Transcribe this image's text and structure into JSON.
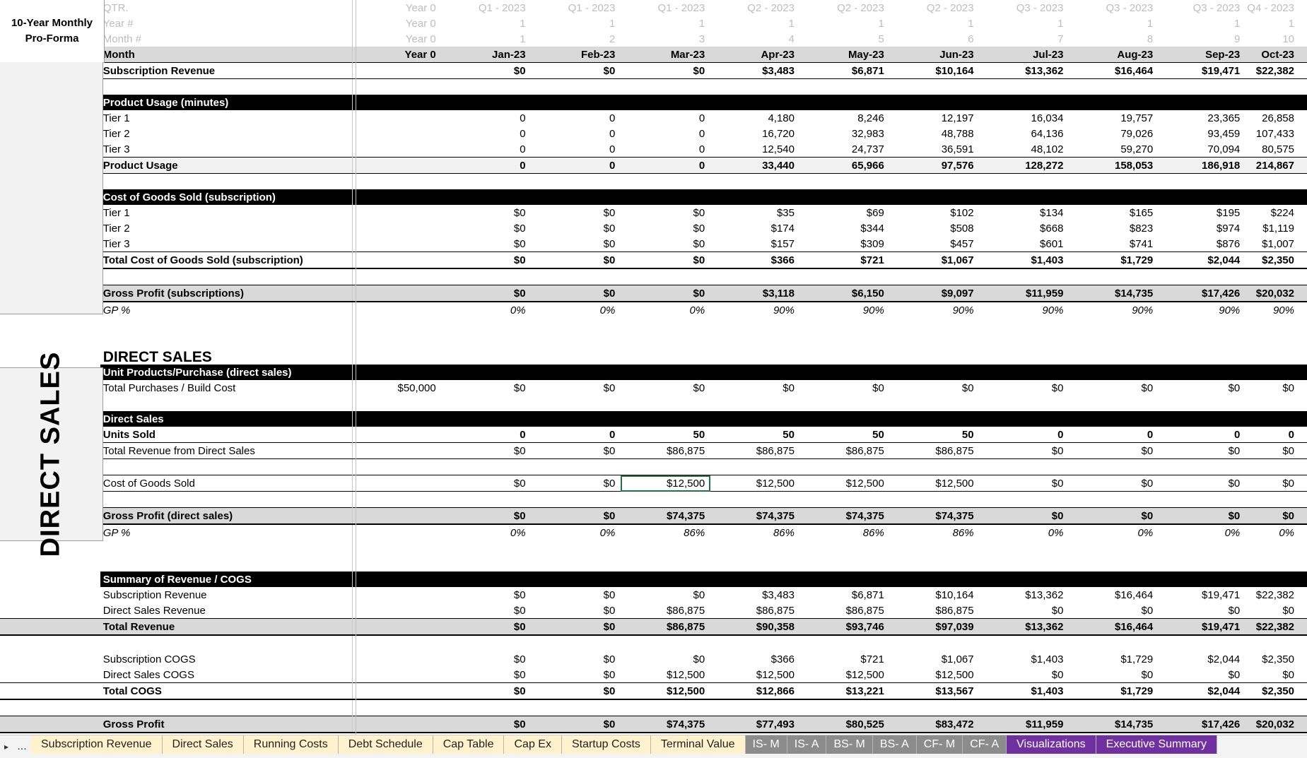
{
  "title_line1": "10-Year Monthly",
  "title_line2": "Pro-Forma",
  "side_label_direct": "DIRECT SALES",
  "header_rows": {
    "qtr_label": "QTR.",
    "year_label": "Year #",
    "month_num_label": "Month #",
    "year0": "Year 0",
    "qtr": [
      "Q1 - 2023",
      "Q1 - 2023",
      "Q1 - 2023",
      "Q2 - 2023",
      "Q2 - 2023",
      "Q2 - 2023",
      "Q3 - 2023",
      "Q3 - 2023",
      "Q3 - 2023",
      "Q4 - 2023"
    ],
    "year": [
      "1",
      "1",
      "1",
      "1",
      "1",
      "1",
      "1",
      "1",
      "1",
      "1"
    ],
    "month_num": [
      "1",
      "2",
      "3",
      "4",
      "5",
      "6",
      "7",
      "8",
      "9",
      "10"
    ]
  },
  "month_row": {
    "label": "Month",
    "year0": "Year 0",
    "months": [
      "Jan-23",
      "Feb-23",
      "Mar-23",
      "Apr-23",
      "May-23",
      "Jun-23",
      "Jul-23",
      "Aug-23",
      "Sep-23",
      "Oct-23"
    ]
  },
  "subscription_revenue": {
    "label": "Subscription Revenue",
    "values": [
      "$0",
      "$0",
      "$0",
      "$3,483",
      "$6,871",
      "$10,164",
      "$13,362",
      "$16,464",
      "$19,471",
      "$22,382"
    ]
  },
  "product_usage": {
    "header": "Product Usage (minutes)",
    "rows": [
      {
        "label": "Tier 1",
        "values": [
          "0",
          "0",
          "0",
          "4,180",
          "8,246",
          "12,197",
          "16,034",
          "19,757",
          "23,365",
          "26,858"
        ]
      },
      {
        "label": "Tier 2",
        "values": [
          "0",
          "0",
          "0",
          "16,720",
          "32,983",
          "48,788",
          "64,136",
          "79,026",
          "93,459",
          "107,433"
        ]
      },
      {
        "label": "Tier 3",
        "values": [
          "0",
          "0",
          "0",
          "12,540",
          "24,737",
          "36,591",
          "48,102",
          "59,270",
          "70,094",
          "80,575"
        ]
      }
    ],
    "total": {
      "label": "Product Usage",
      "values": [
        "0",
        "0",
        "0",
        "33,440",
        "65,966",
        "97,576",
        "128,272",
        "158,053",
        "186,918",
        "214,867"
      ]
    }
  },
  "cogs_sub": {
    "header": "Cost of Goods Sold (subscription)",
    "rows": [
      {
        "label": "Tier 1",
        "values": [
          "$0",
          "$0",
          "$0",
          "$35",
          "$69",
          "$102",
          "$134",
          "$165",
          "$195",
          "$224"
        ]
      },
      {
        "label": "Tier 2",
        "values": [
          "$0",
          "$0",
          "$0",
          "$174",
          "$344",
          "$508",
          "$668",
          "$823",
          "$974",
          "$1,119"
        ]
      },
      {
        "label": "Tier 3",
        "values": [
          "$0",
          "$0",
          "$0",
          "$157",
          "$309",
          "$457",
          "$601",
          "$741",
          "$876",
          "$1,007"
        ]
      }
    ],
    "total": {
      "label": "Total Cost of Goods Sold (subscription)",
      "values": [
        "$0",
        "$0",
        "$0",
        "$366",
        "$721",
        "$1,067",
        "$1,403",
        "$1,729",
        "$2,044",
        "$2,350"
      ]
    }
  },
  "gp_sub": {
    "label": "Gross Profit (subscriptions)",
    "values": [
      "$0",
      "$0",
      "$0",
      "$3,118",
      "$6,150",
      "$9,097",
      "$11,959",
      "$14,735",
      "$17,426",
      "$20,032"
    ]
  },
  "gp_sub_pct": {
    "label": "GP %",
    "values": [
      "0%",
      "0%",
      "0%",
      "90%",
      "90%",
      "90%",
      "90%",
      "90%",
      "90%",
      "90%"
    ]
  },
  "direct_sales_heading": "DIRECT SALES",
  "unit_products": {
    "header": "Unit Products/Purchase (direct sales)",
    "row": {
      "label": "Total Purchases / Build Cost",
      "year0": "$50,000",
      "values": [
        "$0",
        "$0",
        "$0",
        "$0",
        "$0",
        "$0",
        "$0",
        "$0",
        "$0",
        "$0"
      ]
    }
  },
  "direct_sales": {
    "header": "Direct Sales",
    "units": {
      "label": "Units Sold",
      "values": [
        "0",
        "0",
        "50",
        "50",
        "50",
        "50",
        "0",
        "0",
        "0",
        "0"
      ]
    },
    "revenue": {
      "label": "Total Revenue from Direct Sales",
      "values": [
        "$0",
        "$0",
        "$86,875",
        "$86,875",
        "$86,875",
        "$86,875",
        "$0",
        "$0",
        "$0",
        "$0"
      ]
    }
  },
  "direct_cogs": {
    "label": "Cost of Goods Sold",
    "values": [
      "$0",
      "$0",
      "$12,500",
      "$12,500",
      "$12,500",
      "$12,500",
      "$0",
      "$0",
      "$0",
      "$0"
    ]
  },
  "gp_direct": {
    "label": "Gross Profit (direct sales)",
    "values": [
      "$0",
      "$0",
      "$74,375",
      "$74,375",
      "$74,375",
      "$74,375",
      "$0",
      "$0",
      "$0",
      "$0"
    ]
  },
  "gp_direct_pct": {
    "label": "GP %",
    "values": [
      "0%",
      "0%",
      "86%",
      "86%",
      "86%",
      "86%",
      "0%",
      "0%",
      "0%",
      "0%"
    ]
  },
  "summary": {
    "header": "Summary of Revenue / COGS",
    "sub_rev": {
      "label": "Subscription Revenue",
      "values": [
        "$0",
        "$0",
        "$0",
        "$3,483",
        "$6,871",
        "$10,164",
        "$13,362",
        "$16,464",
        "$19,471",
        "$22,382"
      ]
    },
    "direct_rev": {
      "label": "Direct Sales Revenue",
      "values": [
        "$0",
        "$0",
        "$86,875",
        "$86,875",
        "$86,875",
        "$86,875",
        "$0",
        "$0",
        "$0",
        "$0"
      ]
    },
    "total_rev": {
      "label": "Total Revenue",
      "values": [
        "$0",
        "$0",
        "$86,875",
        "$90,358",
        "$93,746",
        "$97,039",
        "$13,362",
        "$16,464",
        "$19,471",
        "$22,382"
      ]
    },
    "sub_cogs": {
      "label": "Subscription COGS",
      "values": [
        "$0",
        "$0",
        "$0",
        "$366",
        "$721",
        "$1,067",
        "$1,403",
        "$1,729",
        "$2,044",
        "$2,350"
      ]
    },
    "direct_cogs": {
      "label": "Direct Sales COGS",
      "values": [
        "$0",
        "$0",
        "$12,500",
        "$12,500",
        "$12,500",
        "$12,500",
        "$0",
        "$0",
        "$0",
        "$0"
      ]
    },
    "total_cogs": {
      "label": "Total COGS",
      "values": [
        "$0",
        "$0",
        "$12,500",
        "$12,866",
        "$13,221",
        "$13,567",
        "$1,403",
        "$1,729",
        "$2,044",
        "$2,350"
      ]
    },
    "gross_profit": {
      "label": "Gross Profit",
      "values": [
        "$0",
        "$0",
        "$74,375",
        "$77,493",
        "$80,525",
        "$83,472",
        "$11,959",
        "$14,735",
        "$17,426",
        "$20,032"
      ]
    }
  },
  "tabs": [
    {
      "label": "Subscription Revenue",
      "style": "yellow"
    },
    {
      "label": "Direct Sales",
      "style": "yellow"
    },
    {
      "label": "Running Costs",
      "style": "yellow"
    },
    {
      "label": "Debt Schedule",
      "style": "yellow"
    },
    {
      "label": "Cap Table",
      "style": "yellow"
    },
    {
      "label": "Cap Ex",
      "style": "yellow"
    },
    {
      "label": "Startup Costs",
      "style": "yellow"
    },
    {
      "label": "Terminal Value",
      "style": "yellow"
    },
    {
      "label": "IS- M",
      "style": "grey"
    },
    {
      "label": "IS- A",
      "style": "grey"
    },
    {
      "label": "BS- M",
      "style": "grey"
    },
    {
      "label": "BS- A",
      "style": "grey"
    },
    {
      "label": "CF- M",
      "style": "grey"
    },
    {
      "label": "CF- A",
      "style": "grey"
    },
    {
      "label": "Visualizations",
      "style": "purple"
    },
    {
      "label": "Executive Summary",
      "style": "purple"
    }
  ],
  "nav": {
    "next": "▸",
    "more": "..."
  },
  "colors": {
    "section_bg": "#000000",
    "subtotal_bg": "#d9d9d9",
    "yellow_tab": "#fff2cc",
    "grey_tab": "#8c8c8c",
    "purple_tab": "#7030a0"
  }
}
